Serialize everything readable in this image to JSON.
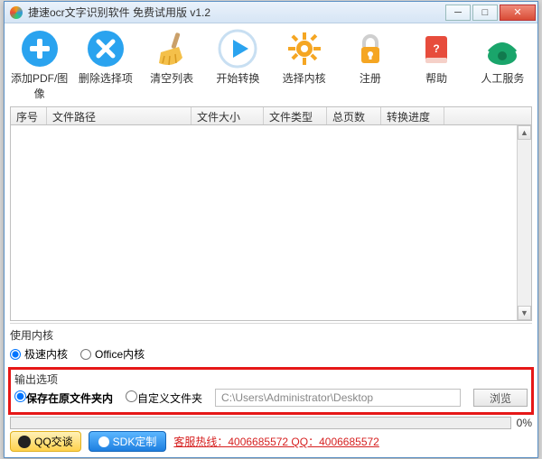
{
  "window": {
    "title": "捷速ocr文字识别软件 免费试用版 v1.2"
  },
  "toolbar": {
    "add": "添加PDF/图像",
    "remove": "删除选择项",
    "clear": "清空列表",
    "start": "开始转换",
    "engine": "选择内核",
    "register": "注册",
    "help": "帮助",
    "service": "人工服务"
  },
  "columns": {
    "c0": "序号",
    "c1": "文件路径",
    "c2": "文件大小",
    "c3": "文件类型",
    "c4": "总页数",
    "c5": "转换进度",
    "c6": ""
  },
  "engine": {
    "title": "使用内核",
    "opt_fast": "极速内核",
    "opt_office": "Office内核"
  },
  "output": {
    "title": "输出选项",
    "opt_same": "保存在原文件夹内",
    "opt_custom": "自定义文件夹",
    "path": "C:\\Users\\Administrator\\Desktop",
    "browse": "浏览"
  },
  "progress": {
    "pct": "0%"
  },
  "footer": {
    "qq": "QQ交谈",
    "sdk": "SDK定制",
    "hotline": "客服热线：4006685572 QQ：4006685572"
  }
}
